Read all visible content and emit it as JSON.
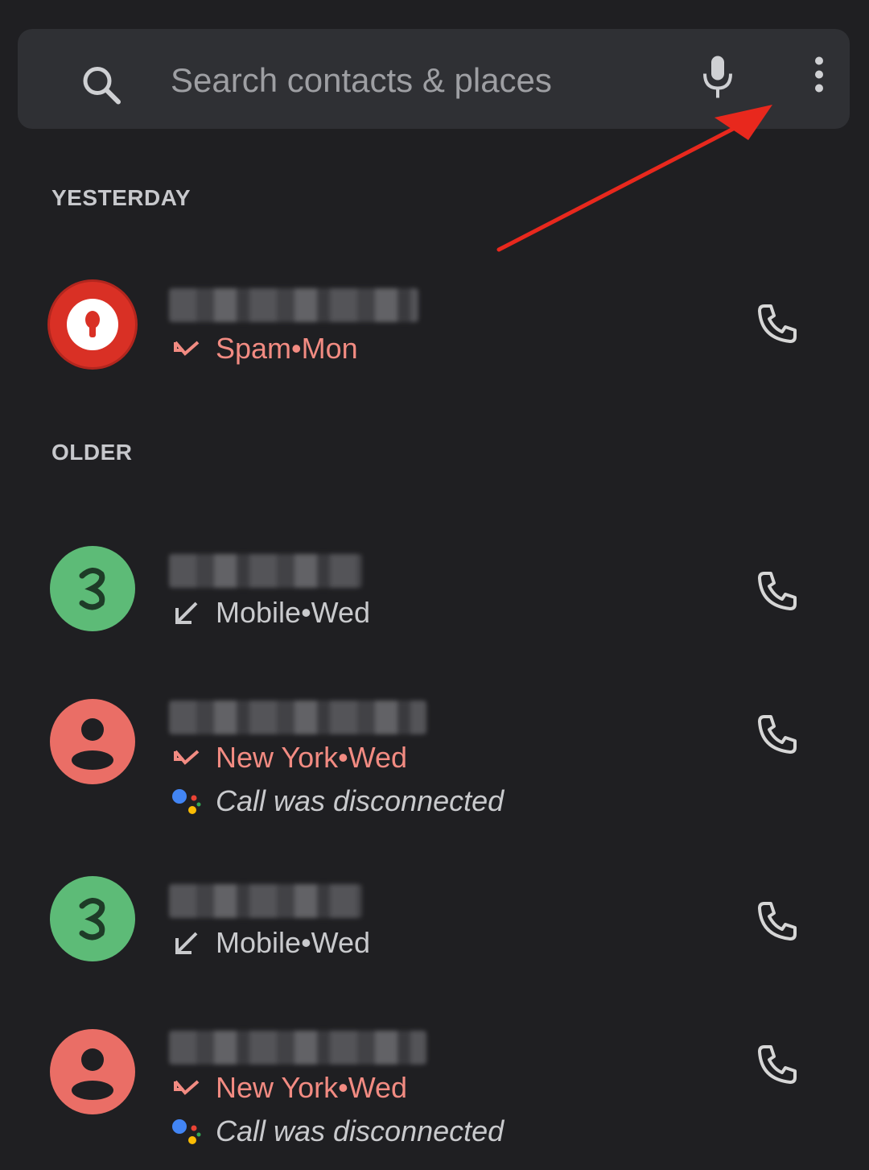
{
  "search": {
    "placeholder": "Search contacts & places",
    "icons": {
      "search": "search-icon",
      "mic": "mic-icon",
      "more": "more-vert-icon"
    }
  },
  "annotation": {
    "color": "#e8281d"
  },
  "sections": {
    "yesterday": "YESTERDAY",
    "older": "OLDER"
  },
  "calls": [
    {
      "avatar": "spam-icon",
      "type": "missed",
      "label": "Spam",
      "sep": " • ",
      "day": "Mon"
    },
    {
      "avatar": "letter-avatar",
      "type": "incoming",
      "label": "Mobile",
      "sep": " • ",
      "day": "Wed"
    },
    {
      "avatar": "person-icon",
      "type": "missed",
      "label": "New York",
      "sep": " • ",
      "day": "Wed",
      "note": "Call was disconnected"
    },
    {
      "avatar": "letter-avatar",
      "type": "incoming",
      "label": "Mobile",
      "sep": " • ",
      "day": "Wed"
    },
    {
      "avatar": "person-icon",
      "type": "missed",
      "label": "New York",
      "sep": " • ",
      "day": "Wed",
      "note": "Call was disconnected"
    }
  ],
  "colors": {
    "background": "#1f1f22",
    "searchBar": "#2f3034",
    "missed": "#f28b82",
    "spam": "#d93025",
    "greenAvatar": "#5dbb77",
    "personAvatar": "#ea6e66"
  }
}
